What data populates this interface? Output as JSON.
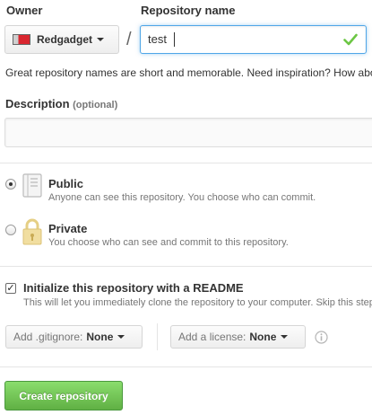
{
  "owner": {
    "label": "Owner",
    "selected": "Redgadget"
  },
  "separator": "/",
  "repository": {
    "label": "Repository name",
    "value": "test",
    "valid_icon": "check-icon"
  },
  "hint": "Great repository names are short and memorable. Need inspiration? How about",
  "description": {
    "label": "Description",
    "optional": "(optional)",
    "value": ""
  },
  "visibility": {
    "public": {
      "title": "Public",
      "desc": "Anyone can see this repository. You choose who can commit.",
      "selected": true,
      "icon": "repo-book-icon"
    },
    "private": {
      "title": "Private",
      "desc": "You choose who can see and commit to this repository.",
      "selected": false,
      "icon": "padlock-icon"
    }
  },
  "readme": {
    "label": "Initialize this repository with a README",
    "desc": "This will let you immediately clone the repository to your computer. Skip this step if you’re importing an existing repository.",
    "checked": true
  },
  "gitignore": {
    "prefix": "Add .gitignore:",
    "value": "None"
  },
  "license": {
    "prefix": "Add a license:",
    "value": "None"
  },
  "info_icon": "info-icon",
  "create_label": "Create repository",
  "colors": {
    "focus": "#51a7e8",
    "check": "#6cc644",
    "green_button": "#60b044",
    "padlock": "#e9d38b"
  }
}
